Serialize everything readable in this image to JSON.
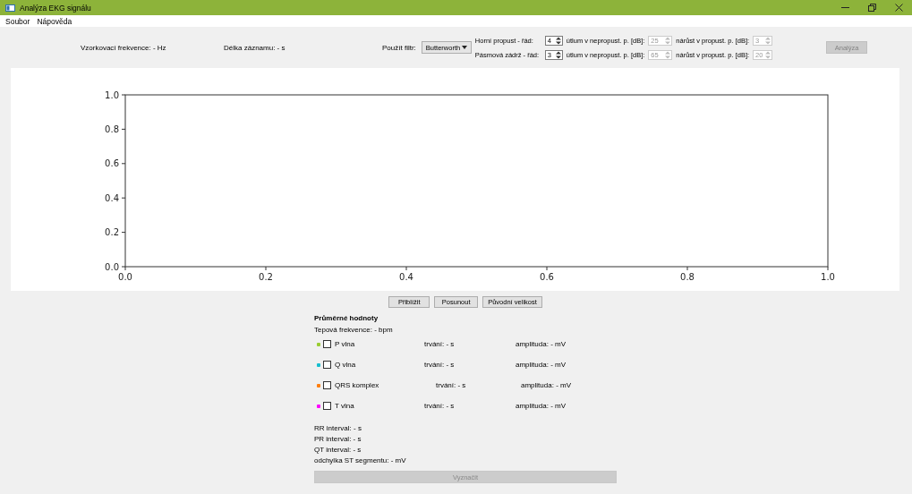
{
  "window": {
    "title": "Analýza EKG signálu"
  },
  "menu": [
    "Soubor",
    "Nápověda"
  ],
  "info": {
    "sampling_rate": "Vzorkovací frekvence: - Hz",
    "record_length": "Délka záznamu: - s"
  },
  "filter": {
    "label": "Použít filtr:",
    "value": "Butterworth"
  },
  "filter_rows": [
    {
      "label": "Horní propust - řád:",
      "order": {
        "value": "4",
        "disabled": false
      },
      "attenuation_label": "útlum v nepropust. p. [dB]:",
      "attenuation": {
        "value": "25",
        "disabled": true
      },
      "gain_label": "nárůst v propust. p. [dB]:",
      "gain": {
        "value": "3",
        "disabled": true
      }
    },
    {
      "label": "Pásmová zádrž - řád:",
      "order": {
        "value": "3",
        "disabled": false
      },
      "attenuation_label": "útlum v nepropust. p. [dB]:",
      "attenuation": {
        "value": "65",
        "disabled": true
      },
      "gain_label": "nárůst v propust. p. [dB]:",
      "gain": {
        "value": "20",
        "disabled": true
      }
    }
  ],
  "analyze_button": {
    "label": "Analýza",
    "disabled": true
  },
  "chart": {
    "chart_data": {
      "type": "line",
      "xlim": [
        0,
        1
      ],
      "ylim": [
        0,
        1
      ],
      "xticks": [
        {
          "value": 0,
          "label": "0.0"
        },
        {
          "value": 0.2,
          "label": "0.2"
        },
        {
          "value": 0.4,
          "label": "0.4"
        },
        {
          "value": 0.6,
          "label": "0.6"
        },
        {
          "value": 0.8,
          "label": "0.8"
        },
        {
          "value": 1,
          "label": "1.0"
        }
      ],
      "yticks": [
        {
          "value": 0,
          "label": "0.0"
        },
        {
          "value": 0.2,
          "label": "0.2"
        },
        {
          "value": 0.4,
          "label": "0.4"
        },
        {
          "value": 0.6,
          "label": "0.6"
        },
        {
          "value": 0.8,
          "label": "0.8"
        },
        {
          "value": 1,
          "label": "1.0"
        }
      ]
    }
  },
  "view_buttons": [
    "Přiblížit",
    "Posunout",
    "Původní velikost"
  ],
  "averages": {
    "title": "Průměrné hodnoty",
    "heart_rate": "Tepová frekvence: - bpm"
  },
  "waves": [
    {
      "color": "#9acd32",
      "checked": false,
      "label": "P vlna",
      "duration": "trvání: - s",
      "amplitude": "amplituda: - mV"
    },
    {
      "color": "#17becf",
      "checked": false,
      "label": "Q vlna",
      "duration": "trvání: - s",
      "amplitude": "amplituda: - mV"
    },
    {
      "color": "#ff7f0e",
      "checked": false,
      "label": "QRS komplex",
      "duration": "trvání: - s",
      "amplitude": "amplituda: - mV"
    },
    {
      "color": "#ff00ff",
      "checked": false,
      "label": "T vlna",
      "duration": "trvání: - s",
      "amplitude": "amplituda: - mV"
    }
  ],
  "intervals": [
    "RR interval: - s",
    "PR interval: - s",
    "QT interval: - s",
    "odchylka ST segmentu: - mV"
  ],
  "mark_button": {
    "label": "Vyznačit",
    "disabled": true
  }
}
